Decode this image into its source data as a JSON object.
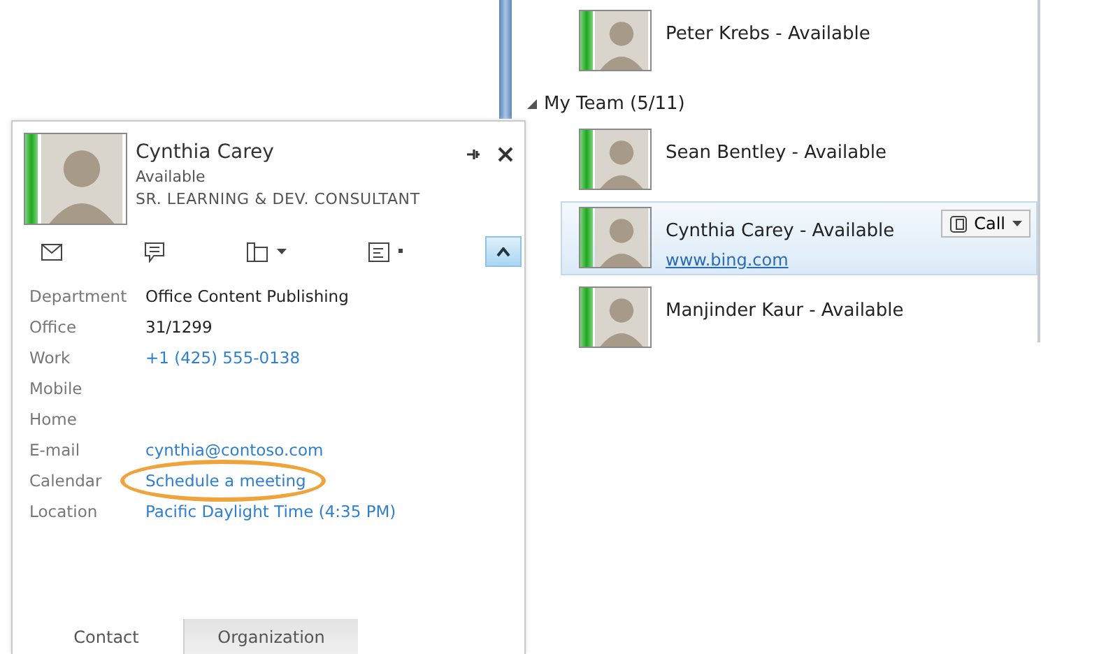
{
  "contact_card": {
    "name": "Cynthia Carey",
    "status": "Available",
    "job_title": "SR. LEARNING & DEV. CONSULTANT",
    "details": [
      {
        "label": "Department",
        "value": "Office Content Publishing",
        "kind": "text"
      },
      {
        "label": "Office",
        "value": "31/1299",
        "kind": "text"
      },
      {
        "label": "Work",
        "value": "+1 (425) 555-0138",
        "kind": "link"
      },
      {
        "label": "Mobile"
      },
      {
        "label": "Home"
      },
      {
        "label": "E-mail",
        "value": "cynthia@contoso.com",
        "kind": "link"
      },
      {
        "label": "Calendar",
        "value": "Schedule a meeting",
        "kind": "link",
        "circled": true
      },
      {
        "label": "Location",
        "value": "Pacific Daylight Time (4:35 PM)",
        "kind": "link"
      }
    ],
    "tabs": [
      {
        "label": "Contact",
        "selected": true
      },
      {
        "label": "Organization",
        "selected": false
      }
    ]
  },
  "contact_list": [
    {
      "kind": "contact",
      "name": "Peter Krebs - Available",
      "selected": false
    },
    {
      "kind": "group",
      "label": "My Team (5/11)",
      "expanded": true,
      "children": [
        {
          "kind": "contact",
          "name": "Sean Bentley - Available",
          "selected": false
        },
        {
          "kind": "contact",
          "name": "Cynthia Carey - Available",
          "note": "www.bing.com",
          "call_button": "Call",
          "selected": true
        },
        {
          "kind": "contact",
          "name": "Manjinder Kaur - Available",
          "selected": false
        }
      ]
    }
  ]
}
